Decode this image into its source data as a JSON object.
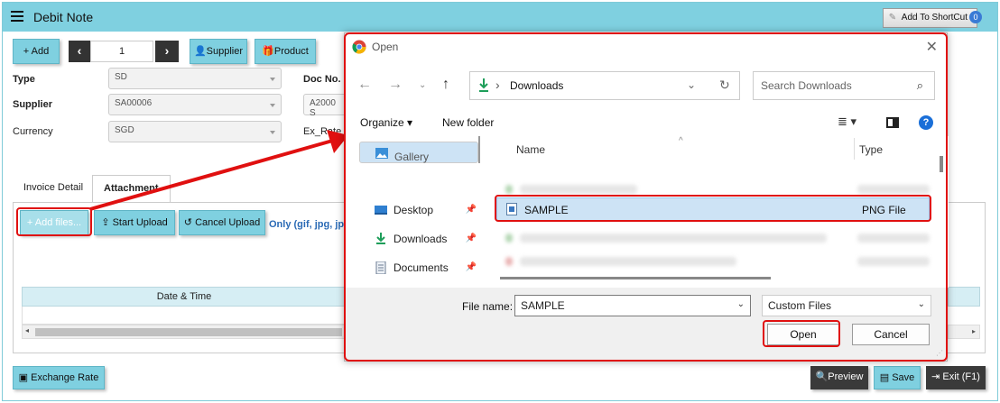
{
  "app": {
    "title": "Debit Note",
    "shortcut_label": "Add To ShortCut",
    "shortcut_count": "0",
    "add_label": "+ Add",
    "prev_label": "‹",
    "next_label": "›",
    "page_number": "1",
    "supplier_label": "Supplier",
    "product_label": "Product"
  },
  "form": {
    "type_label": "Type",
    "type_value": "SD",
    "supplier_label": "Supplier",
    "supplier_value": "SA00006",
    "currency_label": "Currency",
    "currency_value": "SGD",
    "docno_label": "Doc No.",
    "docno_value": "A2000 S",
    "exrate_label": "Ex_Rate"
  },
  "tabs": [
    {
      "label": "Invoice Detail"
    },
    {
      "label": "Attachment"
    }
  ],
  "attachment": {
    "add_files": "+ Add files...",
    "start_upload": "Start Upload",
    "cancel_upload": "Cancel Upload",
    "only_text": "Only (gif, jpg, jpe",
    "col_datetime": "Date & Time"
  },
  "footer": {
    "exchange_rate": "Exchange Rate",
    "preview": "Preview",
    "save": "Save",
    "exit": "Exit (F1)"
  },
  "dialog": {
    "title": "Open",
    "location": "Downloads",
    "search_placeholder": "Search Downloads",
    "organize": "Organize",
    "new_folder": "New folder",
    "nav": {
      "gallery": "Gallery",
      "desktop": "Desktop",
      "downloads": "Downloads",
      "documents": "Documents"
    },
    "col_name": "Name",
    "col_type": "Type",
    "file": {
      "name": "SAMPLE",
      "type": "PNG File"
    },
    "file_name_label": "File name:",
    "file_name_value": "SAMPLE",
    "file_type_value": "Custom Files",
    "open_label": "Open",
    "cancel_label": "Cancel"
  },
  "colors": {
    "accent": "#7fd0e0",
    "highlight": "#e01010",
    "selection": "#cde3f5"
  }
}
